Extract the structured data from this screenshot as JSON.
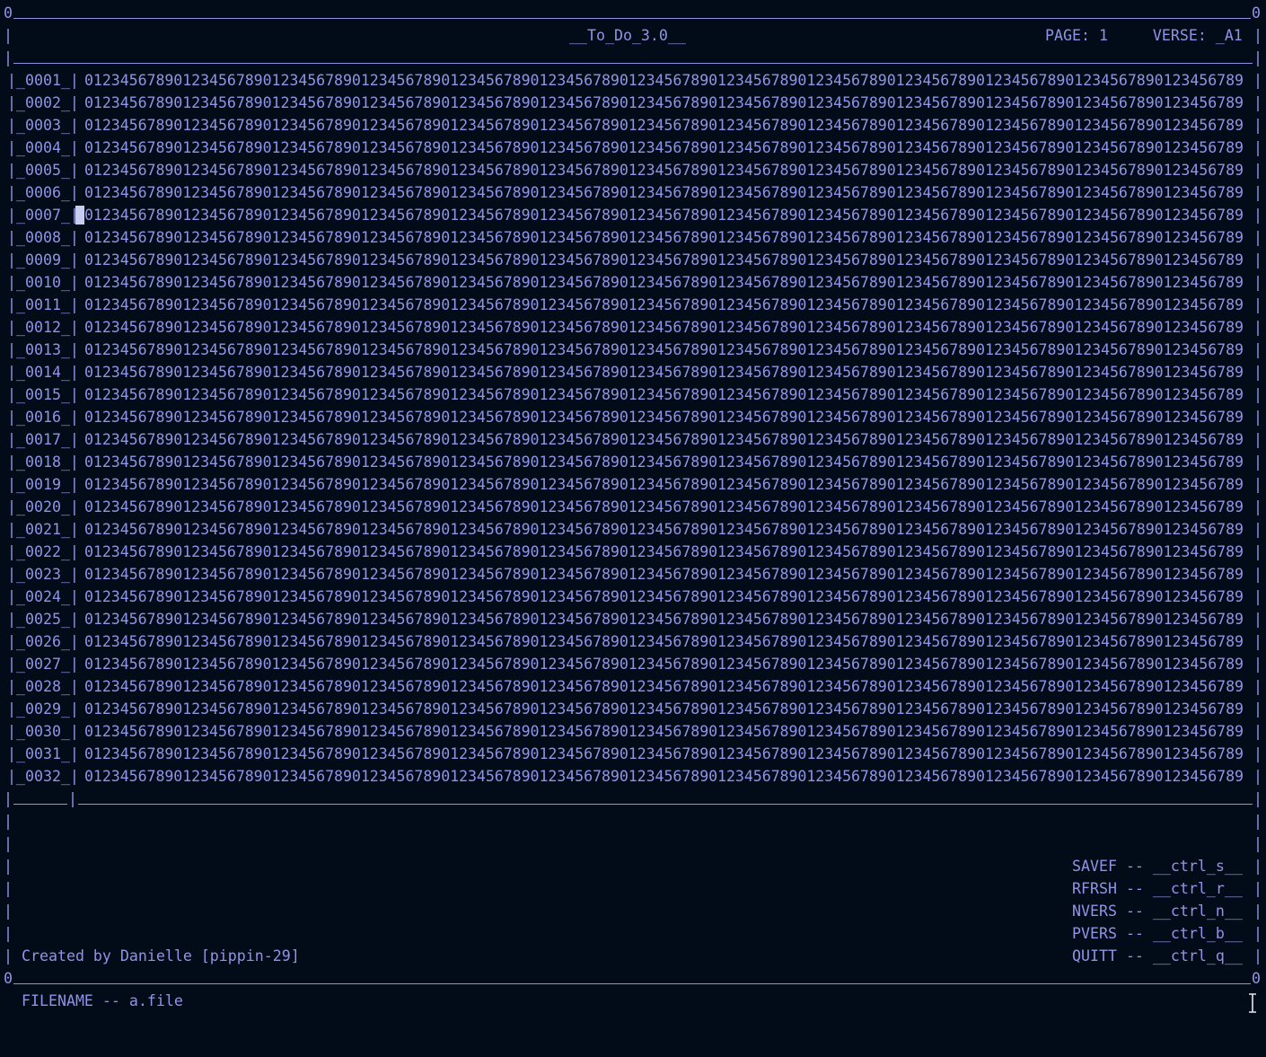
{
  "frame": {
    "corner_left": "0",
    "corner_right": "0",
    "bottom_corner_left": "0",
    "bottom_corner_right": "0",
    "pipe": "|"
  },
  "header": {
    "title": "__To_Do_3.0__",
    "page_label": "PAGE: 1",
    "verse_label": "VERSE: _A1"
  },
  "rows": [
    {
      "num": "|_0001_|",
      "text": "0123456789012345678901234567890123456789012345678901234567890123456789012345678901234567890123456789012345678901234567890123456789012345678"
    },
    {
      "num": "|_0002_|",
      "text": "0123456789012345678901234567890123456789012345678901234567890123456789012345678901234567890123456789012345678901234567890123456789012345678"
    },
    {
      "num": "|_0003_|",
      "text": "0123456789012345678901234567890123456789012345678901234567890123456789012345678901234567890123456789012345678901234567890123456789012345678"
    },
    {
      "num": "|_0004_|",
      "text": "0123456789012345678901234567890123456789012345678901234567890123456789012345678901234567890123456789012345678901234567890123456789012345678"
    },
    {
      "num": "|_0005_|",
      "text": "0123456789012345678901234567890123456789012345678901234567890123456789012345678901234567890123456789012345678901234567890123456789012345678"
    },
    {
      "num": "|_0006_|",
      "text": "0123456789012345678901234567890123456789012345678901234567890123456789012345678901234567890123456789012345678901234567890123456789012345678"
    },
    {
      "num": "|_0007_|",
      "text": "0123456789012345678901234567890123456789012345678901234567890123456789012345678901234567890123456789012345678901234567890123456789012345678"
    },
    {
      "num": "|_0008_|",
      "text": "0123456789012345678901234567890123456789012345678901234567890123456789012345678901234567890123456789012345678901234567890123456789012345678"
    },
    {
      "num": "|_0009_|",
      "text": "0123456789012345678901234567890123456789012345678901234567890123456789012345678901234567890123456789012345678901234567890123456789012345678"
    },
    {
      "num": "|_0010_|",
      "text": "0123456789012345678901234567890123456789012345678901234567890123456789012345678901234567890123456789012345678901234567890123456789012345678"
    },
    {
      "num": "|_0011_|",
      "text": "0123456789012345678901234567890123456789012345678901234567890123456789012345678901234567890123456789012345678901234567890123456789012345678"
    },
    {
      "num": "|_0012_|",
      "text": "0123456789012345678901234567890123456789012345678901234567890123456789012345678901234567890123456789012345678901234567890123456789012345678"
    },
    {
      "num": "|_0013_|",
      "text": "0123456789012345678901234567890123456789012345678901234567890123456789012345678901234567890123456789012345678901234567890123456789012345678"
    },
    {
      "num": "|_0014_|",
      "text": "0123456789012345678901234567890123456789012345678901234567890123456789012345678901234567890123456789012345678901234567890123456789012345678"
    },
    {
      "num": "|_0015_|",
      "text": "0123456789012345678901234567890123456789012345678901234567890123456789012345678901234567890123456789012345678901234567890123456789012345678"
    },
    {
      "num": "|_0016_|",
      "text": "0123456789012345678901234567890123456789012345678901234567890123456789012345678901234567890123456789012345678901234567890123456789012345678"
    },
    {
      "num": "|_0017_|",
      "text": "0123456789012345678901234567890123456789012345678901234567890123456789012345678901234567890123456789012345678901234567890123456789012345678"
    },
    {
      "num": "|_0018_|",
      "text": "0123456789012345678901234567890123456789012345678901234567890123456789012345678901234567890123456789012345678901234567890123456789012345678"
    },
    {
      "num": "|_0019_|",
      "text": "0123456789012345678901234567890123456789012345678901234567890123456789012345678901234567890123456789012345678901234567890123456789012345678"
    },
    {
      "num": "|_0020_|",
      "text": "0123456789012345678901234567890123456789012345678901234567890123456789012345678901234567890123456789012345678901234567890123456789012345678"
    },
    {
      "num": "|_0021_|",
      "text": "0123456789012345678901234567890123456789012345678901234567890123456789012345678901234567890123456789012345678901234567890123456789012345678"
    },
    {
      "num": "|_0022_|",
      "text": "0123456789012345678901234567890123456789012345678901234567890123456789012345678901234567890123456789012345678901234567890123456789012345678"
    },
    {
      "num": "|_0023_|",
      "text": "0123456789012345678901234567890123456789012345678901234567890123456789012345678901234567890123456789012345678901234567890123456789012345678"
    },
    {
      "num": "|_0024_|",
      "text": "0123456789012345678901234567890123456789012345678901234567890123456789012345678901234567890123456789012345678901234567890123456789012345678"
    },
    {
      "num": "|_0025_|",
      "text": "0123456789012345678901234567890123456789012345678901234567890123456789012345678901234567890123456789012345678901234567890123456789012345678"
    },
    {
      "num": "|_0026_|",
      "text": "0123456789012345678901234567890123456789012345678901234567890123456789012345678901234567890123456789012345678901234567890123456789012345678"
    },
    {
      "num": "|_0027_|",
      "text": "0123456789012345678901234567890123456789012345678901234567890123456789012345678901234567890123456789012345678901234567890123456789012345678"
    },
    {
      "num": "|_0028_|",
      "text": "0123456789012345678901234567890123456789012345678901234567890123456789012345678901234567890123456789012345678901234567890123456789012345678"
    },
    {
      "num": "|_0029_|",
      "text": "0123456789012345678901234567890123456789012345678901234567890123456789012345678901234567890123456789012345678901234567890123456789012345678"
    },
    {
      "num": "|_0030_|",
      "text": "0123456789012345678901234567890123456789012345678901234567890123456789012345678901234567890123456789012345678901234567890123456789012345678"
    },
    {
      "num": "|_0031_|",
      "text": "0123456789012345678901234567890123456789012345678901234567890123456789012345678901234567890123456789012345678901234567890123456789012345678"
    },
    {
      "num": "|_0032_|",
      "text": "0123456789012345678901234567890123456789012345678901234567890123456789012345678901234567890123456789012345678901234567890123456789012345678"
    }
  ],
  "footer": {
    "credit": "Created by Danielle [pippin-29]",
    "shortcuts": [
      {
        "label": "SAVEF -- __ctrl_s__"
      },
      {
        "label": "RFRSH -- __ctrl_r__"
      },
      {
        "label": "NVERS -- __ctrl_n__"
      },
      {
        "label": "PVERS -- __ctrl_b__"
      },
      {
        "label": "QUITT -- __ctrl_q__"
      }
    ]
  },
  "status": {
    "filename": "FILENAME -- a.file"
  },
  "colors": {
    "background": "#020b18",
    "text": "#8f95e6",
    "cursor": "#c8cbf2"
  }
}
